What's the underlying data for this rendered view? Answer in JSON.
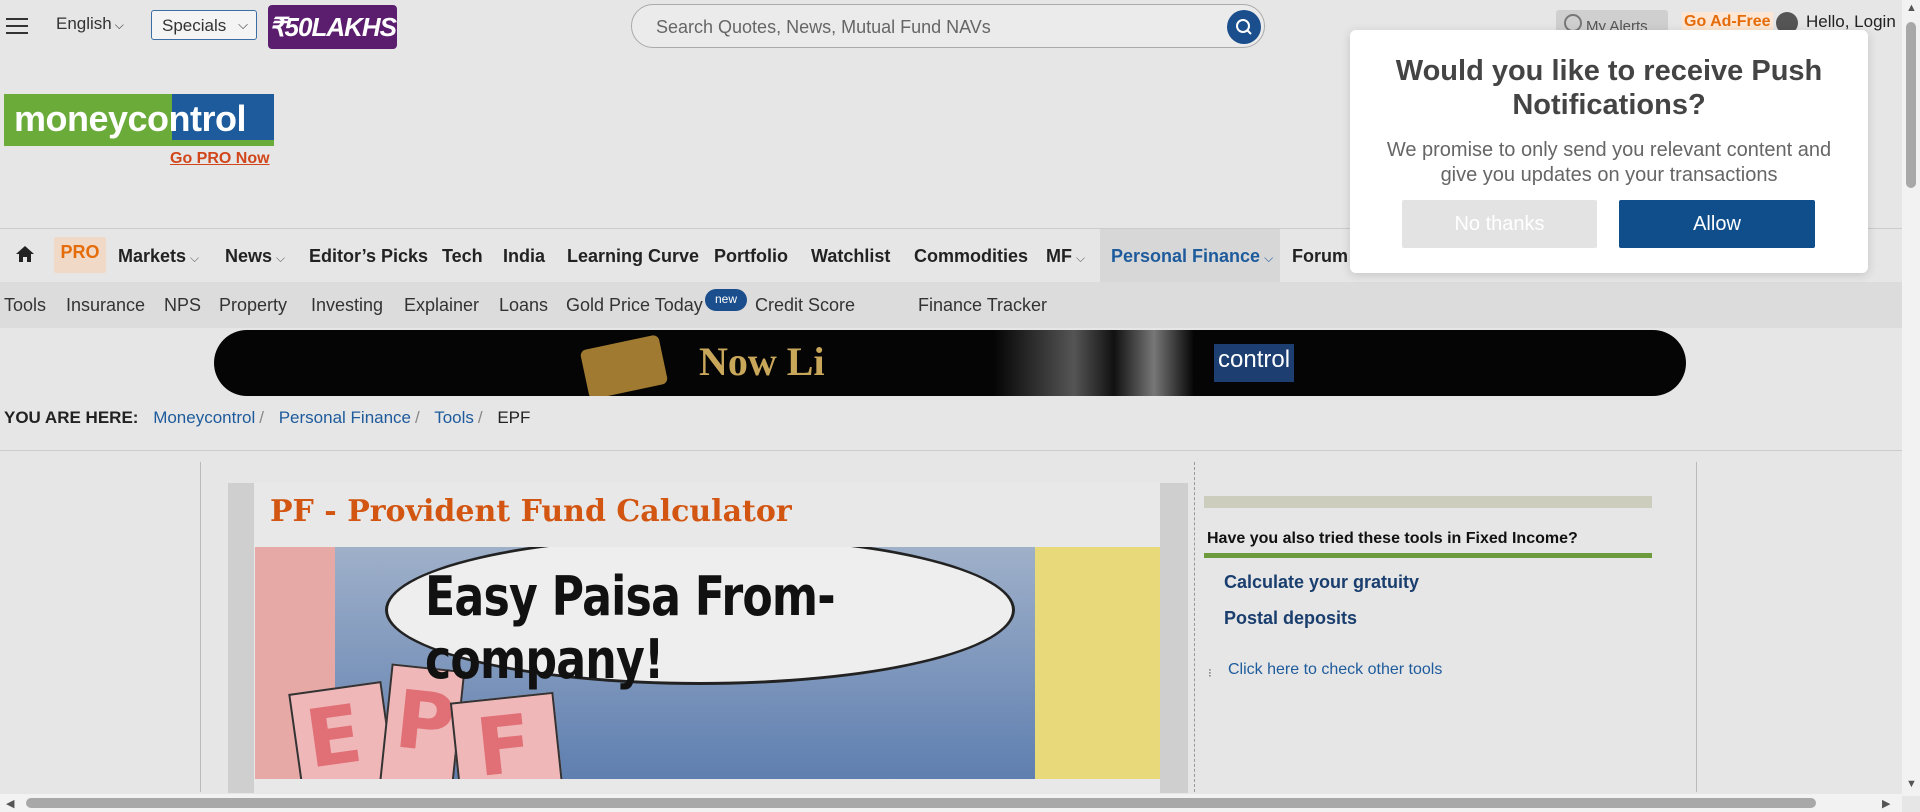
{
  "topbar": {
    "language": "English",
    "specials": "Specials",
    "promo": "₹50LAKHS",
    "search_placeholder": "Search Quotes, News, Mutual Fund NAVs",
    "alerts": "My Alerts",
    "adfree": "Go Ad-Free",
    "login": "Hello, Login"
  },
  "logo": {
    "text": "moneycontrol",
    "gopro": "Go PRO Now"
  },
  "nav": {
    "pro": "PRO",
    "items": [
      "Markets",
      "News",
      "Editor’s Picks",
      "Tech",
      "India",
      "Learning Curve",
      "Portfolio",
      "Watchlist",
      "Commodities",
      "MF",
      "Personal Finance",
      "Forum"
    ]
  },
  "subnav": {
    "items": [
      "Tools",
      "Insurance",
      "NPS",
      "Property",
      "Investing",
      "Explainer",
      "Loans",
      "Gold Price Today",
      "Credit Score",
      "Finance Tracker"
    ],
    "new_badge": "new"
  },
  "banner": {
    "text": "Now Li",
    "brand": "control"
  },
  "breadcrumb": {
    "label": "YOU ARE HERE:",
    "items": [
      "Moneycontrol",
      "Personal Finance",
      "Tools"
    ],
    "current": "EPF"
  },
  "main": {
    "title": "PF - Provident Fund Calculator",
    "illustration_text": "Easy Paisa From-company!",
    "illustration_letters": [
      "E",
      "P",
      "F"
    ]
  },
  "sidebar": {
    "heading": "Have you also tried these tools in Fixed Income?",
    "links": [
      "Calculate your gratuity",
      "Postal deposits"
    ],
    "other_tools": "Click here to check other tools"
  },
  "popup": {
    "title": "Would you like to receive Push Notifications?",
    "message": "We promise to only send you relevant content and give you updates on your transactions",
    "no_label": "No thanks",
    "yes_label": "Allow"
  },
  "colors": {
    "accent_blue": "#1e5b9c",
    "orange": "#d25612",
    "green": "#6aab3a"
  }
}
